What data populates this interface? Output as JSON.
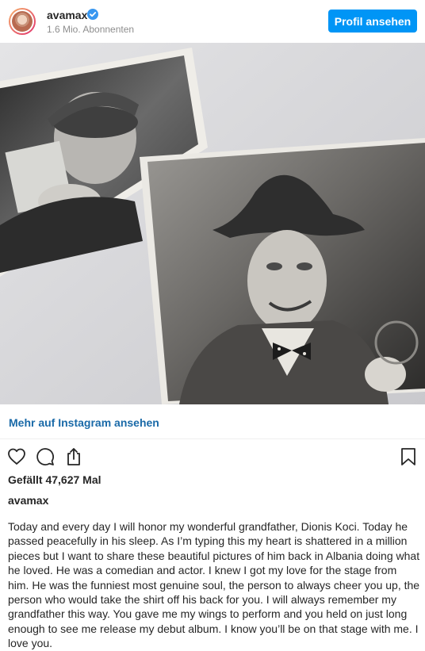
{
  "header": {
    "username": "avamax",
    "followers": "1.6 Mio. Abonnenten",
    "profile_button": "Profil ansehen",
    "verified_icon": "verified-badge-icon"
  },
  "post": {
    "more_link": "Mehr auf Instagram ansehen",
    "likes": "Gefällt 47,627 Mal",
    "author": "avamax",
    "caption": "Today and every day I will honor my wonderful grandfather, Dionis Koci. Today he passed peacefully in his sleep. As I’m typing this my heart is shattered in a million pieces but I want to share these beautiful pictures of him back in Albania doing what he loved. He was a comedian and actor. I knew I got my love for the stage from him. He was the funniest most genuine soul, the person to always cheer you up, the person who would take the shirt off his back for you. I will always remember my grandfather this way. You gave me my wings to perform and you held on just long enough to see me release my debut album. I know you’ll be on that stage with me. I love you."
  },
  "actions": {
    "icons": [
      "heart-icon",
      "comment-icon",
      "share-icon",
      "bookmark-icon"
    ]
  },
  "colors": {
    "accent": "#0095f6",
    "link": "#1a6aa8",
    "text": "#262626",
    "muted": "#8e8e8e"
  }
}
